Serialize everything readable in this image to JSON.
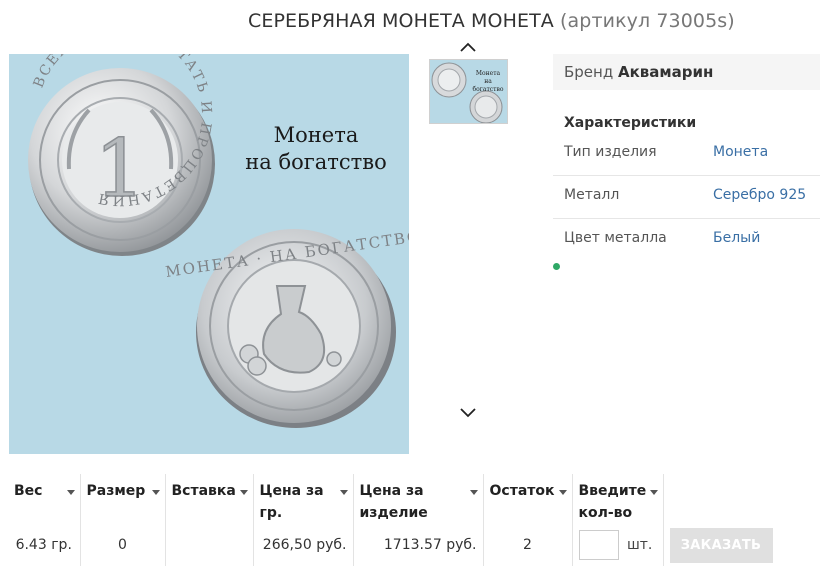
{
  "product": {
    "title": "СЕРЕБРЯНАЯ МОНЕТА МОНЕТА",
    "sku_text": "(артикул 73005s)"
  },
  "gallery": {
    "main_caption_line1": "Монета",
    "main_caption_line2": "на богатство",
    "thumb_caption_line1": "Монета",
    "thumb_caption_line2": "на богатство",
    "coin_front_ring_text": "ВСЕХ БЛАГ · ПОСТАТЬ И ПРОЦВЕТАНИЯ",
    "coin_front_value": "1",
    "coin_back_ring_text": "МОНЕТА · НА БОГАТСТВО"
  },
  "info": {
    "brand_label": "Бренд",
    "brand_value": "Аквамарин",
    "characteristics_title": "Характеристики",
    "rows": [
      {
        "key": "Тип изделия",
        "value": "Монета"
      },
      {
        "key": "Металл",
        "value": "Серебро 925"
      },
      {
        "key": "Цвет металла",
        "value": "Белый"
      }
    ]
  },
  "offers": {
    "headers": [
      "Вес",
      "Размер",
      "Вставка",
      "Цена за гр.",
      "Цена за изделие",
      "Остаток",
      "Введите кол-во"
    ],
    "header_lines": {
      "price_gr_1": "Цена за",
      "price_gr_2": "гр.",
      "price_item_1": "Цена за",
      "price_item_2": "изделие",
      "qty_1": "Введите",
      "qty_2": "кол-во"
    },
    "row": {
      "weight": "6.43 гр.",
      "size": "0",
      "insert": "",
      "price_per_gram": "266,50 руб.",
      "price_per_item": "1713.57 руб.",
      "stock": "2",
      "qty_value": "",
      "unit": "шт."
    },
    "order_button": "ЗАКАЗАТЬ"
  },
  "colors": {
    "image_background": "#b8d9e6",
    "link": "#3a6fa5",
    "status_dot": "#2fa866",
    "order_button_bg": "#e0e0e0"
  }
}
